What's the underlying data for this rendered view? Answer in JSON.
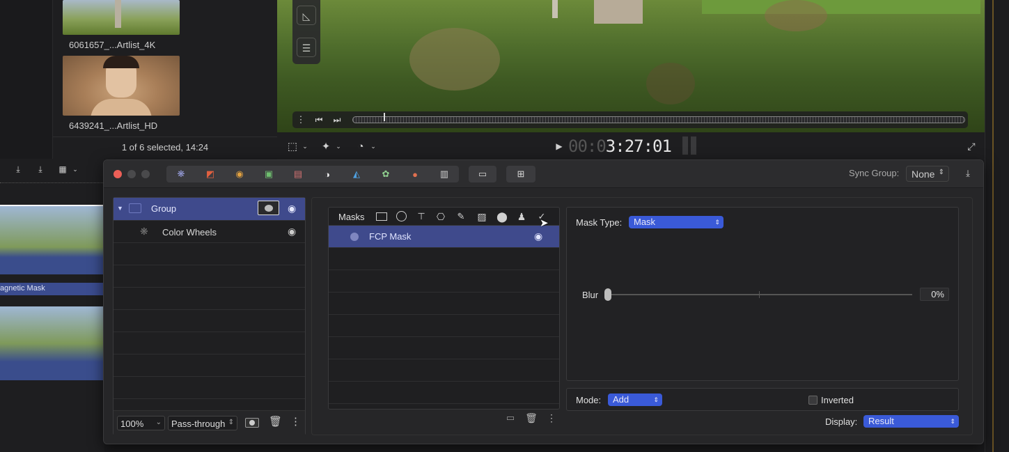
{
  "browser": {
    "clip1_name": "6061657_...Artlist_4K",
    "clip2_name": "6439241_...Artlist_HD",
    "selection_status": "1 of 6 selected, 14:24"
  },
  "viewer": {
    "timecode_dim": "00:0",
    "timecode": "3:27:01"
  },
  "timeline": {
    "clip_label": "agnetic Mask"
  },
  "panel": {
    "sync_group_label": "Sync Group:",
    "sync_group_value": "None",
    "layers": [
      {
        "label": "Group"
      },
      {
        "label": "Color Wheels"
      }
    ],
    "zoom_value": "100%",
    "blend_value": "Pass-through",
    "masks_title": "Masks",
    "mask_rows": [
      {
        "label": "FCP Mask"
      }
    ],
    "mask_type_label": "Mask Type:",
    "mask_type_value": "Mask",
    "blur_label": "Blur",
    "blur_value": "0%",
    "blur_fraction": 0,
    "mode_label": "Mode:",
    "mode_value": "Add",
    "inverted_label": "Inverted",
    "inverted_checked": false,
    "display_label": "Display:",
    "display_value": "Result"
  },
  "colors": {
    "accent": "#3a5ad8",
    "selection": "#3f4a8c",
    "close": "#ec5f57"
  }
}
